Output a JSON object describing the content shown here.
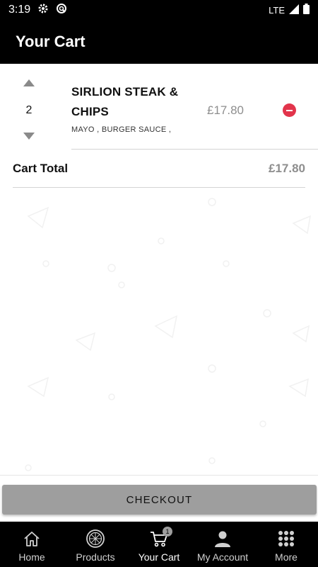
{
  "status_bar": {
    "time": "3:19",
    "network": "LTE",
    "icons": [
      "gear-icon",
      "sync-icon",
      "signal-icon",
      "battery-icon"
    ]
  },
  "app_bar": {
    "title": "Your Cart"
  },
  "cart": {
    "items": [
      {
        "quantity": "2",
        "name_line1": "SIRLION STEAK &",
        "name_line2": "CHIPS",
        "options": "MAYO , BURGER SAUCE ,",
        "price": "£17.80"
      }
    ],
    "total_label": "Cart Total",
    "total_value": "£17.80"
  },
  "checkout": {
    "label": "CHECKOUT"
  },
  "bottom_nav": {
    "items": [
      {
        "label": "Home",
        "icon": "home-icon"
      },
      {
        "label": "Products",
        "icon": "pizza-icon"
      },
      {
        "label": "Your Cart",
        "icon": "cart-icon",
        "badge": "1",
        "active": true
      },
      {
        "label": "My Account",
        "icon": "account-icon"
      },
      {
        "label": "More",
        "icon": "grid-icon"
      }
    ]
  },
  "colors": {
    "header_bg": "#000000",
    "remove": "#e2344b",
    "price": "#8e8e8e",
    "checkout_bg": "#9e9e9e"
  }
}
